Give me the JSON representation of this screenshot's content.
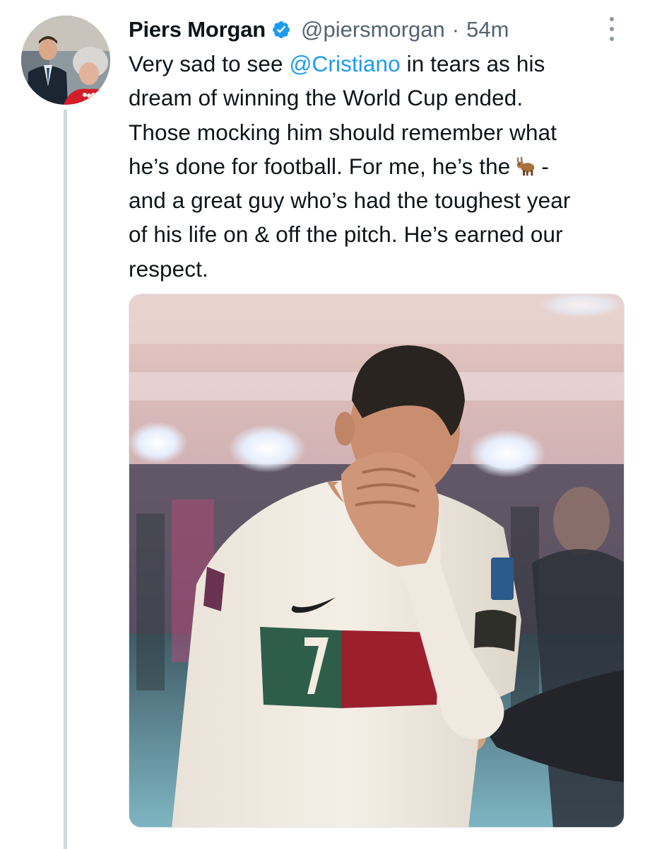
{
  "tweet": {
    "author": {
      "name": "Piers Morgan",
      "handle": "@piersmorgan",
      "verified": true,
      "avatar_icon": "profile-photo"
    },
    "separator": "·",
    "time": "54m",
    "more_icon": "more-vertical-icon",
    "text_lines": [
      {
        "before": "Very sad to see ",
        "mention": "@Cristiano",
        "after": " in tears as his"
      },
      {
        "text": "dream of winning the World Cup ended."
      },
      {
        "text": "Those mocking him should remember what"
      },
      {
        "text": "he’s done for football. For me, he’s the",
        "emoji": "goat-emoji",
        "after": "-"
      },
      {
        "text": "and a great guy who’s had the toughest year"
      },
      {
        "text": "of his life on & off the pitch. He’s earned our"
      },
      {
        "text": "respect."
      }
    ],
    "media": {
      "type": "photo",
      "jersey_number": "7"
    }
  },
  "colors": {
    "link": "#1d9bf0",
    "text": "#0f1419",
    "secondary": "#536471",
    "thread_line": "#cfd9de",
    "verified": "#1d9bf0"
  }
}
